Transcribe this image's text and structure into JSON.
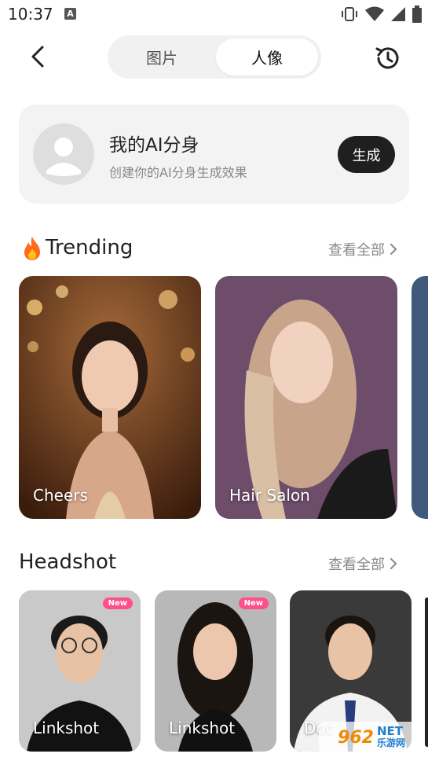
{
  "status_bar": {
    "time": "10:37",
    "notif_icon": "A"
  },
  "nav": {
    "tabs": [
      {
        "label": "图片",
        "active": false
      },
      {
        "label": "人像",
        "active": true
      }
    ]
  },
  "ai_card": {
    "title": "我的AI分身",
    "subtitle": "创建你的AI分身生成效果",
    "button": "生成"
  },
  "trending": {
    "title": "Trending",
    "more": "查看全部",
    "cards": [
      {
        "label": "Cheers"
      },
      {
        "label": "Hair Salon"
      },
      {
        "label": ""
      }
    ]
  },
  "headshot": {
    "title": "Headshot",
    "more": "查看全部",
    "cards": [
      {
        "label": "Linkshot",
        "badge": "New"
      },
      {
        "label": "Linkshot",
        "badge": "New"
      },
      {
        "label": "Doc"
      }
    ]
  },
  "watermark": {
    "num": "962",
    "net": "NET",
    "site": "乐游网"
  },
  "colors": {
    "accent_dark": "#1f1f1f",
    "badge_pink": "#ff4f8b",
    "card_bg": "#f3f3f3"
  }
}
